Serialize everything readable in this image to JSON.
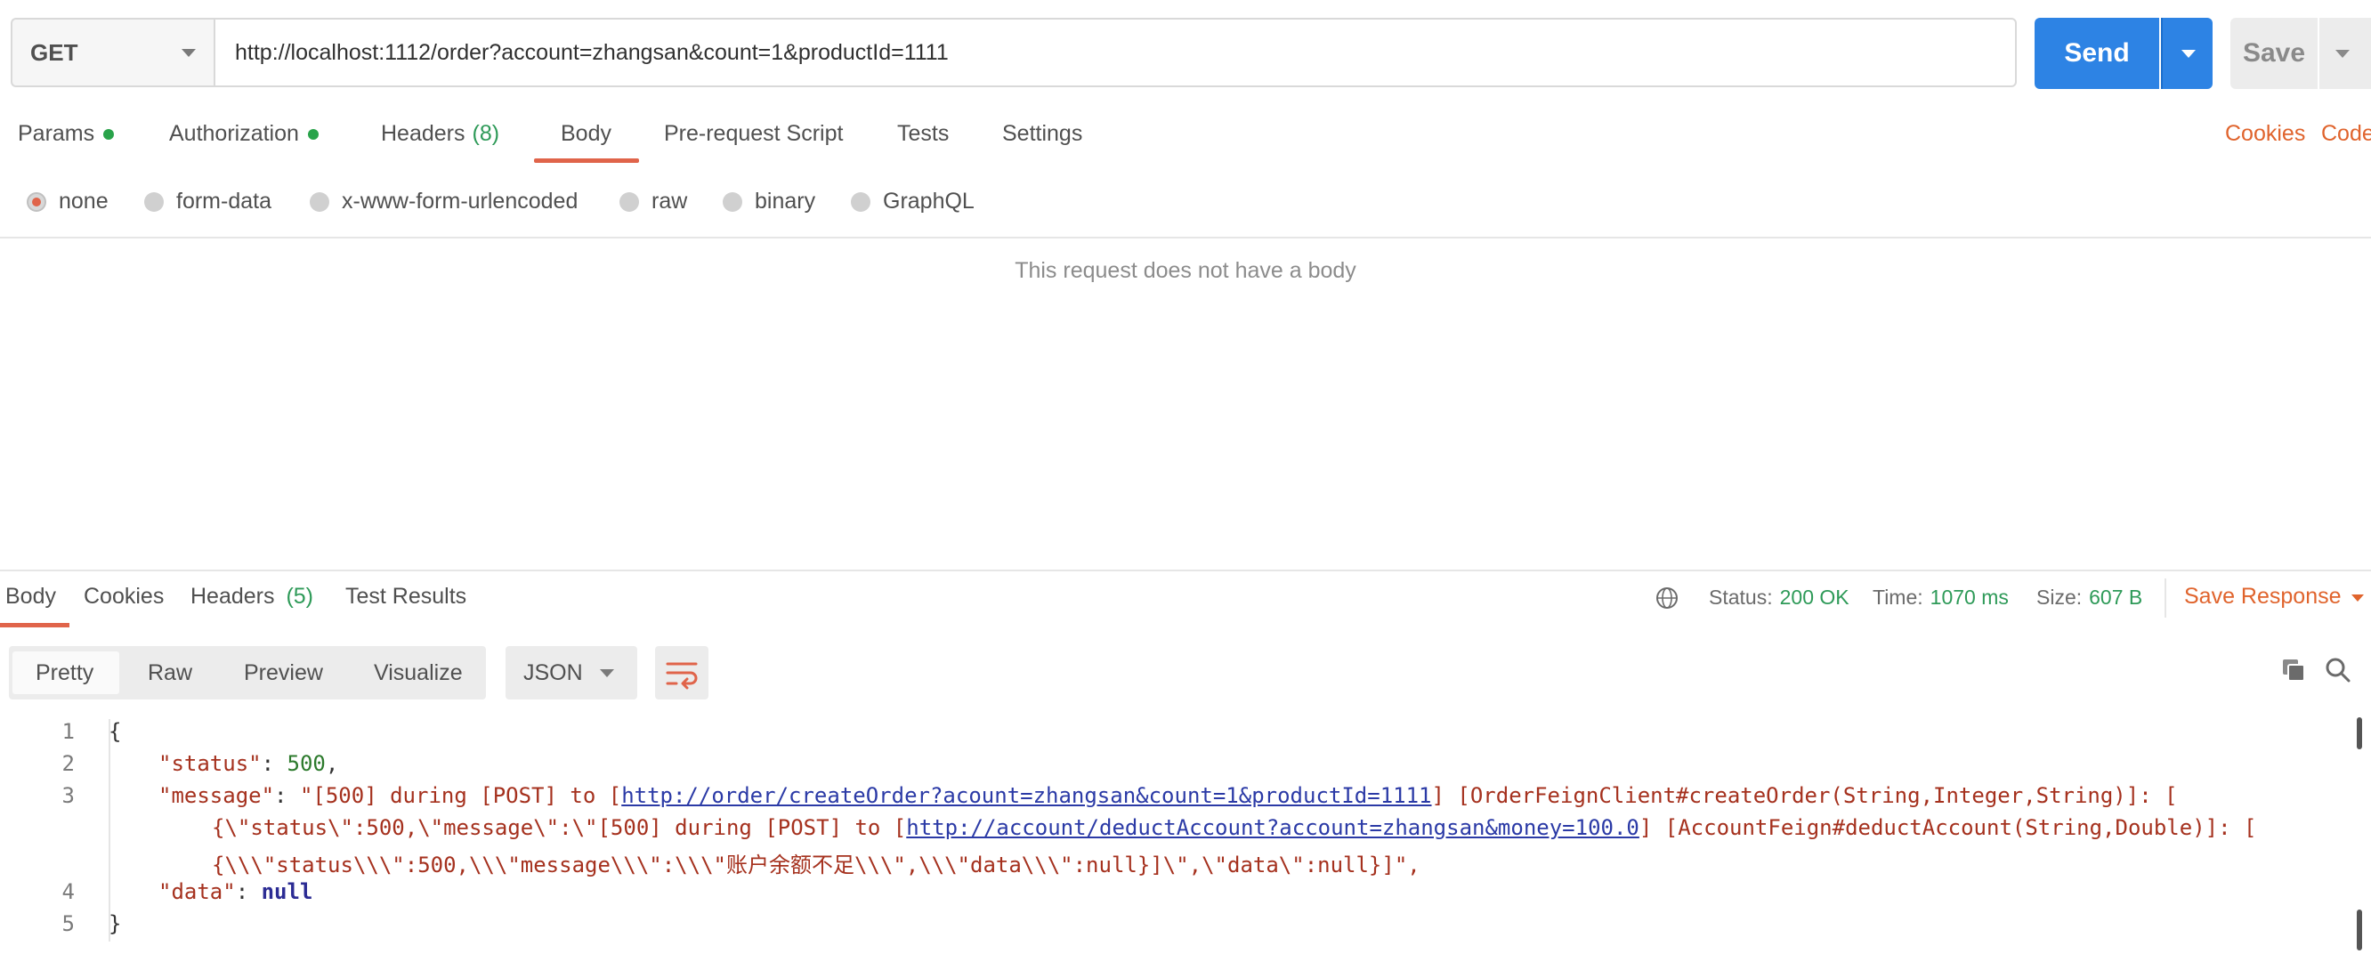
{
  "request": {
    "method": "GET",
    "url": "http://localhost:1112/order?account=zhangsan&count=1&productId=1111",
    "send_label": "Send",
    "save_label": "Save"
  },
  "request_tabs": [
    {
      "label": "Params",
      "has_dot": true
    },
    {
      "label": "Authorization",
      "has_dot": true
    },
    {
      "label": "Headers",
      "count": "(8)"
    },
    {
      "label": "Body",
      "active": true
    },
    {
      "label": "Pre-request Script"
    },
    {
      "label": "Tests"
    },
    {
      "label": "Settings"
    }
  ],
  "right_links": {
    "cookies": "Cookies",
    "code": "Code"
  },
  "body_types": [
    "none",
    "form-data",
    "x-www-form-urlencoded",
    "raw",
    "binary",
    "GraphQL"
  ],
  "body_type_selected": "none",
  "no_body_message": "This request does not have a body",
  "response_tabs": [
    {
      "label": "Body",
      "active": true
    },
    {
      "label": "Cookies"
    },
    {
      "label": "Headers",
      "count": "(5)"
    },
    {
      "label": "Test Results"
    }
  ],
  "response_status": {
    "status_label": "Status:",
    "status_value": "200 OK",
    "time_label": "Time:",
    "time_value": "1070 ms",
    "size_label": "Size:",
    "size_value": "607 B",
    "save_response": "Save Response"
  },
  "view_modes": [
    "Pretty",
    "Raw",
    "Preview",
    "Visualize"
  ],
  "view_mode_selected": "Pretty",
  "format": "JSON",
  "code_lines": {
    "n1": "1",
    "n2": "2",
    "n3": "3",
    "n4": "4",
    "n5": "5",
    "open": "{",
    "status_key": "\"status\"",
    "status_val": "500",
    "message_key": "\"message\"",
    "msg_p1": "\"[500] during [POST] to [",
    "msg_url1": "http://order/createOrder?acount=zhangsan&count=1&productId=1111",
    "msg_p2": "] [OrderFeignClient#createOrder(String,Integer,String)]: [",
    "msg_p3": "{\\\"status\\\":500,\\\"message\\\":\\\"[500] during [POST] to [",
    "msg_url2": "http://account/deductAccount?account=zhangsan&money=100.0",
    "msg_p4": "] [AccountFeign#deductAccount(String,Double)]: [",
    "msg_p5": "{\\\\\\\"status\\\\\\\":500,\\\\\\\"message\\\\\\\":\\\\\\\"账户余额不足\\\\\\\",\\\\\\\"data\\\\\\\":null}]\\\",\\\"data\\\":null}]\",",
    "data_key": "\"data\"",
    "data_val": "null",
    "close": "}"
  },
  "icons": {
    "method_caret": "chevron-down-icon",
    "send_caret": "chevron-down-icon",
    "save_caret": "chevron-down-icon",
    "globe": "globe-icon",
    "wrap": "wrap-lines-icon",
    "copy": "copy-icon",
    "search": "search-icon"
  },
  "colors": {
    "accent_orange": "#e0644a",
    "send_blue": "#2d83e4",
    "status_green": "#2e9a58"
  }
}
